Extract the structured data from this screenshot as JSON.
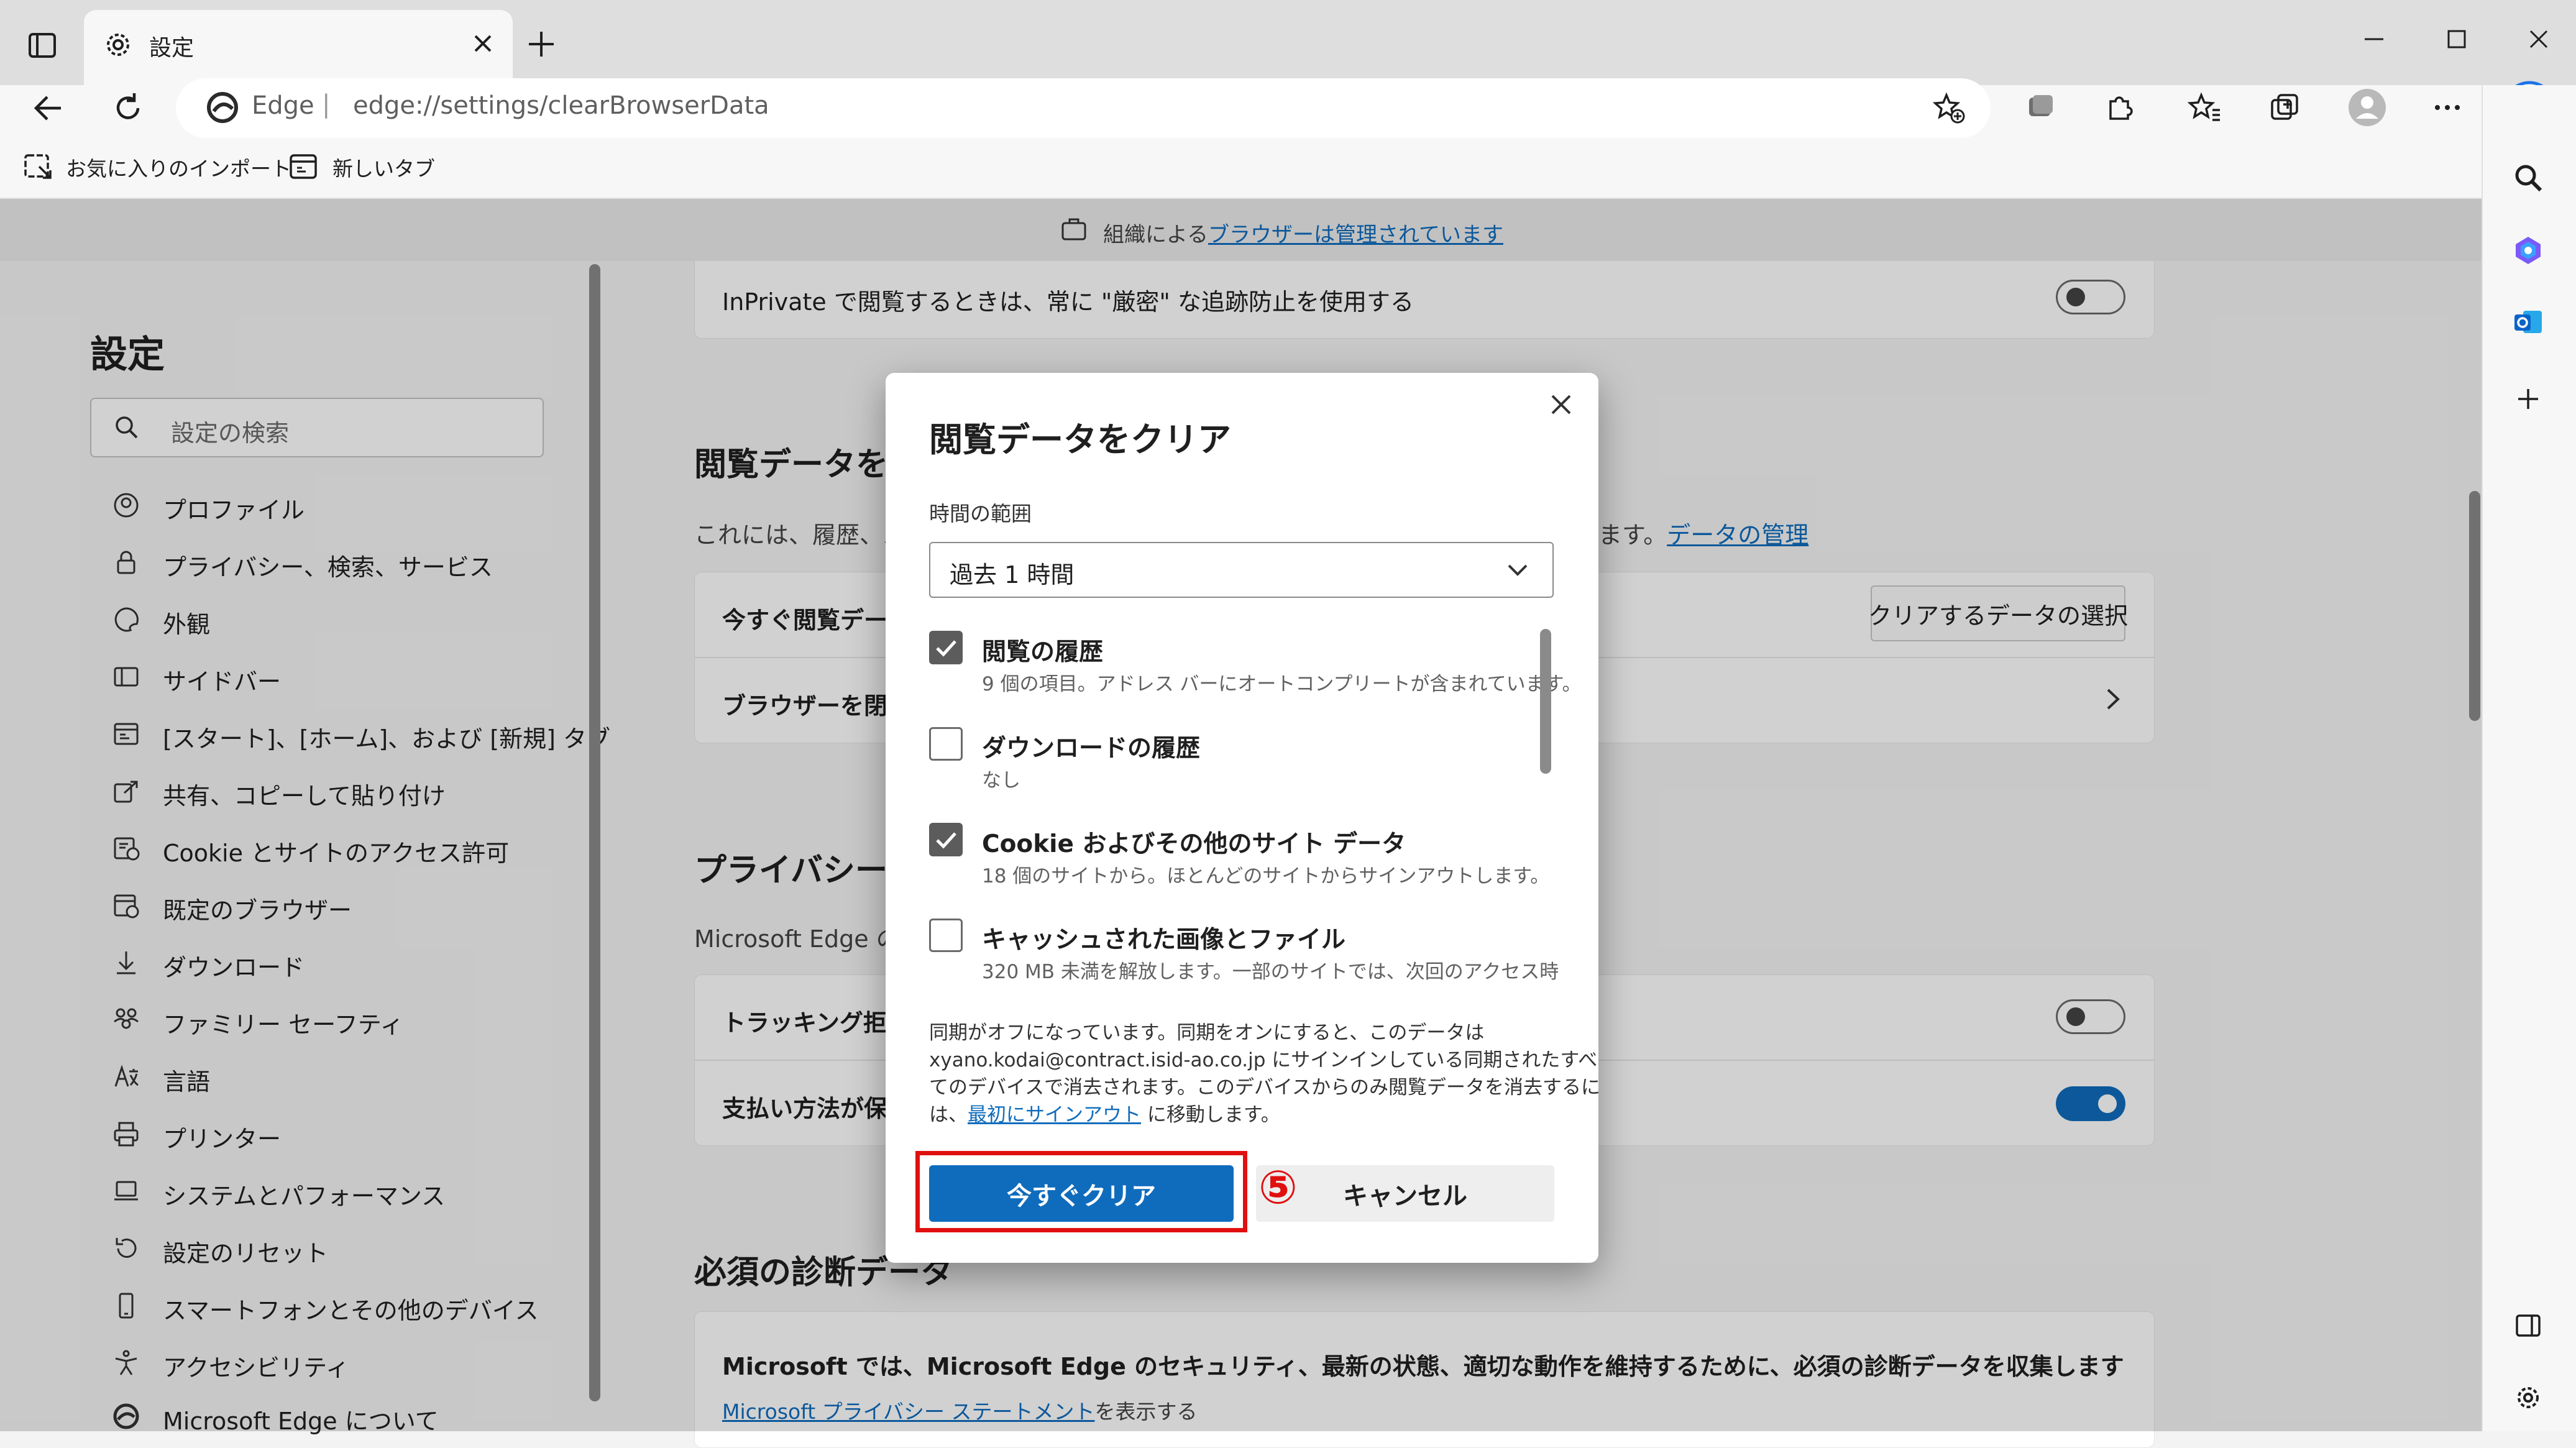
{
  "browser": {
    "tab_title": "設定",
    "address_prefix": "Edge",
    "address_separator": "|",
    "address_url": "edge://settings/clearBrowserData",
    "favorites": [
      {
        "label": "お気に入りのインポート"
      },
      {
        "label": "新しいタブ"
      }
    ]
  },
  "managed_banner": {
    "prefix": "組織による",
    "link": "ブラウザーは管理されています"
  },
  "sidebar": {
    "title": "設定",
    "search_placeholder": "設定の検索",
    "items": [
      {
        "label": "プロファイル",
        "icon": "profile-icon"
      },
      {
        "label": "プライバシー、検索、サービス",
        "icon": "lock-icon"
      },
      {
        "label": "外観",
        "icon": "palette-icon"
      },
      {
        "label": "サイドバー",
        "icon": "sidebar-icon"
      },
      {
        "label": "[スタート]、[ホーム]、および [新規] タブ",
        "icon": "home-tab-icon"
      },
      {
        "label": "共有、コピーして貼り付け",
        "icon": "share-icon"
      },
      {
        "label": "Cookie とサイトのアクセス許可",
        "icon": "cookie-icon"
      },
      {
        "label": "既定のブラウザー",
        "icon": "default-browser-icon"
      },
      {
        "label": "ダウンロード",
        "icon": "download-icon"
      },
      {
        "label": "ファミリー セーフティ",
        "icon": "family-icon"
      },
      {
        "label": "言語",
        "icon": "language-icon"
      },
      {
        "label": "プリンター",
        "icon": "printer-icon"
      },
      {
        "label": "システムとパフォーマンス",
        "icon": "system-icon"
      },
      {
        "label": "設定のリセット",
        "icon": "reset-icon"
      },
      {
        "label": "スマートフォンとその他のデバイス",
        "icon": "phone-icon"
      },
      {
        "label": "アクセシビリティ",
        "icon": "accessibility-icon"
      },
      {
        "label": "Microsoft Edge について",
        "icon": "edge-icon"
      }
    ]
  },
  "main": {
    "inprivate_label": "InPrivate で閲覧するときは、常に \"厳密\" な追跡防止を使用する",
    "clear_section_title": "閲覧データをク",
    "clear_section_desc": "これには、履歴、パス",
    "clear_section_desc_tail": "ます。",
    "manage_data_link": "データの管理",
    "clear_now_label": "今すぐ閲覧データ",
    "choose_button": "クリアするデータの選択",
    "on_close_label": "ブラウザーを閉じる",
    "privacy_title": "プライバシー",
    "privacy_desc": "Microsoft Edge の",
    "tracking_label": "トラッキング拒否",
    "payment_label": "支払い方法が保",
    "diagnostics_title": "必須の診断データ",
    "diagnostics_desc": "Microsoft では、Microsoft Edge のセキュリティ、最新の状態、適切な動作を維持するために、必須の診断データを収集します",
    "privacy_statement_link": "Microsoft プライバシー ステートメント",
    "privacy_statement_tail": "を表示する"
  },
  "dialog": {
    "title": "閲覧データをクリア",
    "time_range_label": "時間の範囲",
    "time_range_value": "過去 1 時間",
    "items": [
      {
        "label": "閲覧の履歴",
        "desc": "9 個の項目。アドレス バーにオートコンプリートが含まれています。",
        "checked": true
      },
      {
        "label": "ダウンロードの履歴",
        "desc": "なし",
        "checked": false
      },
      {
        "label": "Cookie およびその他のサイト データ",
        "desc": "18 個のサイトから。ほとんどのサイトからサインアウトします。",
        "checked": true
      },
      {
        "label": "キャッシュされた画像とファイル",
        "desc": "320 MB 未満を解放します。一部のサイトでは、次回のアクセス時",
        "checked": false
      }
    ],
    "sync_line1": "同期がオフになっています。同期をオンにすると、このデータは",
    "sync_line2": "xyano.kodai@contract.isid-ao.co.jp にサインインしている同期されたすべ",
    "sync_line3": "てのデバイスで消去されます。このデバイスからのみ閲覧データを消去するに",
    "sync_line4_prefix": "は、",
    "sync_link": "最初にサインアウト",
    "sync_line4_suffix": " に移動します。",
    "clear_button": "今すぐクリア",
    "cancel_button": "キャンセル"
  },
  "annotation": {
    "step": "⑤",
    "color": "#e01010"
  }
}
